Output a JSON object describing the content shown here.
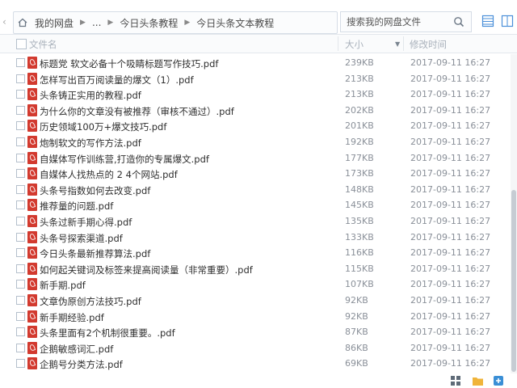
{
  "breadcrumb": {
    "items": [
      "我的网盘",
      "...",
      "今日头条教程",
      "今日头条文本教程"
    ]
  },
  "search": {
    "placeholder": "搜索我的网盘文件"
  },
  "columns": {
    "name": "文件名",
    "size": "大小",
    "modified": "修改时间"
  },
  "files": [
    {
      "name": "标题党 软文必备十个吸睛标题写作技巧.pdf",
      "size": "239KB",
      "modified": "2017-09-11 16:27"
    },
    {
      "name": "怎样写出百万阅读量的爆文（1）.pdf",
      "size": "213KB",
      "modified": "2017-09-11 16:27"
    },
    {
      "name": "头条铸正实用的教程.pdf",
      "size": "213KB",
      "modified": "2017-09-11 16:27"
    },
    {
      "name": "为什么你的文章没有被推荐（审核不通过）.pdf",
      "size": "202KB",
      "modified": "2017-09-11 16:27"
    },
    {
      "name": "历史领域100万+爆文技巧.pdf",
      "size": "201KB",
      "modified": "2017-09-11 16:27"
    },
    {
      "name": "炮制软文的写作方法.pdf",
      "size": "192KB",
      "modified": "2017-09-11 16:27"
    },
    {
      "name": "自媒体写作训练营,打造你的专属爆文.pdf",
      "size": "177KB",
      "modified": "2017-09-11 16:27"
    },
    {
      "name": "自媒体人找热点的 2 4个网站.pdf",
      "size": "173KB",
      "modified": "2017-09-11 16:27"
    },
    {
      "name": "头条号指数如何去改变.pdf",
      "size": "148KB",
      "modified": "2017-09-11 16:27"
    },
    {
      "name": "推荐量的问题.pdf",
      "size": "145KB",
      "modified": "2017-09-11 16:27"
    },
    {
      "name": "头条过新手期心得.pdf",
      "size": "135KB",
      "modified": "2017-09-11 16:27"
    },
    {
      "name": "头条号探索渠道.pdf",
      "size": "133KB",
      "modified": "2017-09-11 16:27"
    },
    {
      "name": "今日头条最新推荐算法.pdf",
      "size": "116KB",
      "modified": "2017-09-11 16:27"
    },
    {
      "name": "如何起关键词及标签来提高阅读量（非常重要）.pdf",
      "size": "115KB",
      "modified": "2017-09-11 16:27"
    },
    {
      "name": "新手期.pdf",
      "size": "107KB",
      "modified": "2017-09-11 16:27"
    },
    {
      "name": "文章伪原创方法技巧.pdf",
      "size": "92KB",
      "modified": "2017-09-11 16:27"
    },
    {
      "name": "新手期经验.pdf",
      "size": "92KB",
      "modified": "2017-09-11 16:27"
    },
    {
      "name": "头条里面有2个机制很重要。.pdf",
      "size": "87KB",
      "modified": "2017-09-11 16:27"
    },
    {
      "name": "企鹅敏感词汇.pdf",
      "size": "86KB",
      "modified": "2017-09-11 16:27"
    },
    {
      "name": "企鹅号分类方法.pdf",
      "size": "69KB",
      "modified": "2017-09-11 16:27"
    }
  ]
}
